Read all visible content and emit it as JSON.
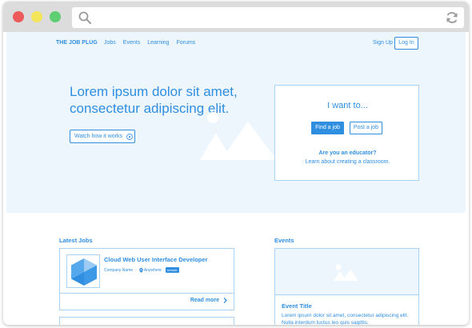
{
  "colors": {
    "accent": "#2f8ee0",
    "hero_bg": "#eef6fd",
    "border": "#a9d2f3",
    "chrome": "#dcdcdc",
    "close": "#ec5a5a",
    "minimize": "#f3e45a",
    "maximize": "#5fce72"
  },
  "browser": {
    "icons": [
      "search-icon",
      "refresh-icon"
    ]
  },
  "nav": {
    "brand": "THE JOB PLUG",
    "links": [
      "Jobs",
      "Events",
      "Learning",
      "Forums"
    ],
    "signup": "Sign Up",
    "login": "Log In"
  },
  "hero": {
    "headline": "Lorem ipsum dolor sit amet, consectetur adipiscing elit.",
    "watch_label": "Watch how it works",
    "watch_icon": "play-circle-icon",
    "illustration_icon": "mountains-icon"
  },
  "want_card": {
    "title": "I want to...",
    "find_label": "Find a job",
    "post_label": "Post a job",
    "educator_question": "Are you an educator?",
    "educator_link": "Learn about creating a classroom."
  },
  "latest_jobs": {
    "title": "Latest Jobs",
    "jobs": [
      {
        "title": "Cloud Web User Interface Developer",
        "company": "Company Name",
        "location": "Anywhere",
        "badge": "remote",
        "logo_icon": "company-logo-icon"
      }
    ],
    "read_more": "Read more"
  },
  "events": {
    "title": "Events",
    "items": [
      {
        "image_icon": "image-placeholder-icon",
        "title": "Event Title",
        "description": "Lorem ipsum dolor sit amet, consectetur adipiscing elit. Nulla interdum luctus leo quis sagittis."
      }
    ]
  }
}
